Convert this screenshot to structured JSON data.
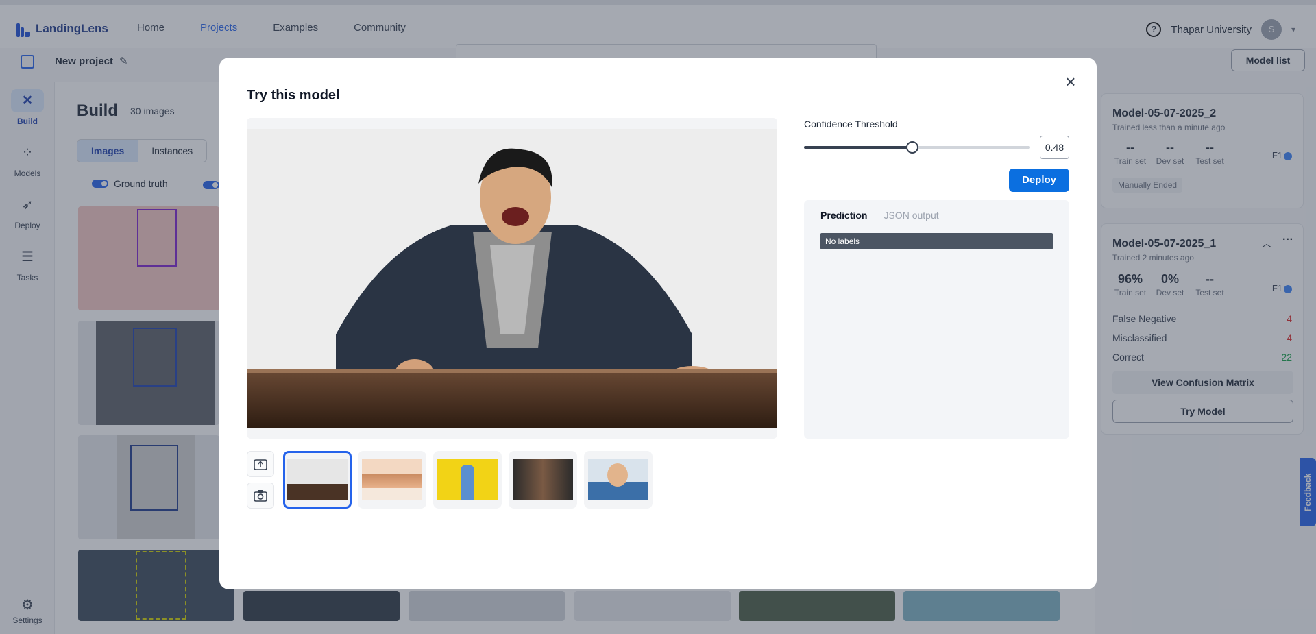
{
  "app": {
    "brand": "LandingLens",
    "nav": [
      "Home",
      "Projects",
      "Examples",
      "Community"
    ],
    "org": "Thapar University",
    "avatar_initial": "S",
    "project_name": "New project",
    "model_list_label": "Model list"
  },
  "sidebar": {
    "items": [
      {
        "label": "Build",
        "icon": "build-icon"
      },
      {
        "label": "Models",
        "icon": "models-icon"
      },
      {
        "label": "Deploy",
        "icon": "deploy-icon"
      },
      {
        "label": "Tasks",
        "icon": "tasks-icon"
      },
      {
        "label": "Settings",
        "icon": "gear-icon"
      }
    ]
  },
  "build": {
    "title": "Build",
    "count": "30 images",
    "tabs": [
      "Images",
      "Instances"
    ],
    "ground_truth": "Ground truth"
  },
  "models": [
    {
      "name": "Model-05-07-2025_2",
      "trained": "Trained less than a minute ago",
      "train": "--",
      "dev": "--",
      "test": "--",
      "train_label": "Train set",
      "dev_label": "Dev set",
      "test_label": "Test set",
      "f1": "F1",
      "status": "Manually Ended"
    },
    {
      "name": "Model-05-07-2025_1",
      "trained": "Trained 2 minutes ago",
      "train": "96%",
      "dev": "0%",
      "test": "--",
      "train_label": "Train set",
      "dev_label": "Dev set",
      "test_label": "Test set",
      "f1": "F1",
      "stats": [
        {
          "label": "False Negative",
          "value": "4"
        },
        {
          "label": "Misclassified",
          "value": "4"
        },
        {
          "label": "Correct",
          "value": "22"
        }
      ],
      "confusion_label": "View Confusion Matrix",
      "try_label": "Try Model"
    }
  ],
  "feedback": "Feedback",
  "modal": {
    "title": "Try this model",
    "confidence_label": "Confidence Threshold",
    "threshold": "0.48",
    "threshold_fraction": 0.48,
    "deploy_label": "Deploy",
    "tabs": [
      "Prediction",
      "JSON output"
    ],
    "no_labels": "No labels"
  },
  "colors": {
    "accent": "#0b6fe0",
    "red": "#dc2626",
    "green": "#16a34a"
  }
}
